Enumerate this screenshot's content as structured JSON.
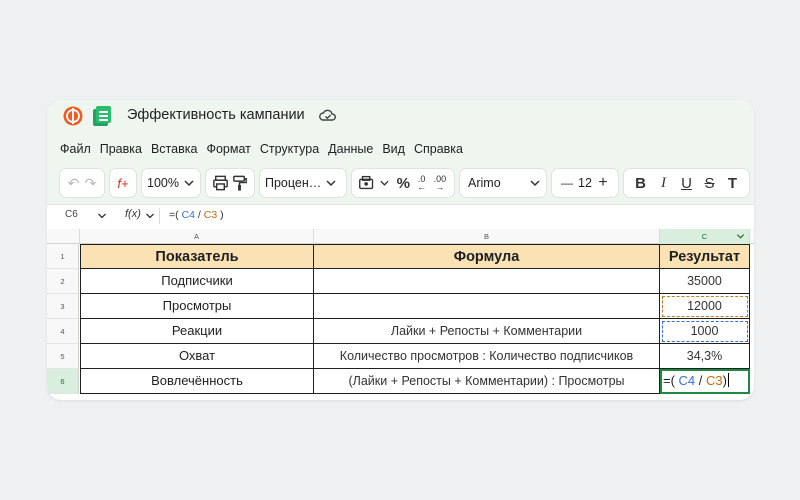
{
  "app": {
    "title": "Эффективность кампании"
  },
  "menu": [
    "Файл",
    "Правка",
    "Вставка",
    "Формат",
    "Структура",
    "Данные",
    "Вид",
    "Справка"
  ],
  "toolbar": {
    "zoom": "100%",
    "number_format": "Процен…",
    "percent_symbol": "%",
    "decimals_label": ".0",
    "font": "Arimo",
    "font_size": "12",
    "minus": "—",
    "plus": "+",
    "bold": "B",
    "italic": "I",
    "strike": "S",
    "text_size": "T"
  },
  "formula_bar": {
    "cell_ref": "C6",
    "fx": "f(x)",
    "formula_prefix": "=(",
    "ref1": "C4",
    "slash": "/",
    "ref2": "C3",
    "formula_suffix": ")"
  },
  "grid": {
    "columns": [
      "A",
      "B",
      "C"
    ],
    "row_numbers": [
      "1",
      "2",
      "3",
      "4",
      "5",
      "6"
    ],
    "rows": [
      {
        "a": "Показатель",
        "b": "Формула",
        "c": "Результат"
      },
      {
        "a": "Подписчики",
        "b": "",
        "c": "35000"
      },
      {
        "a": "Просмотры",
        "b": "",
        "c": "12000"
      },
      {
        "a": "Реакции",
        "b": "Лайки + Репосты + Комментарии",
        "c": "1000"
      },
      {
        "a": "Охват",
        "b": "Количество просмотров : Количество подписчиков",
        "c": "34,3%"
      },
      {
        "a": "Вовлечённость",
        "b": "(Лайки + Репосты + Комментарии) : Просмотры",
        "c": ""
      }
    ],
    "active_formula": {
      "prefix": "=(",
      "ref1": "C4",
      "slash": "/",
      "ref2": "C3",
      "suffix": ")"
    }
  },
  "colors": {
    "header_fill": "#fbe2b4",
    "active_border": "#1d8a43",
    "ref_blue": "#3b6fd4",
    "ref_orange": "#c36a14",
    "chrome_bg": "#eef6ef"
  }
}
